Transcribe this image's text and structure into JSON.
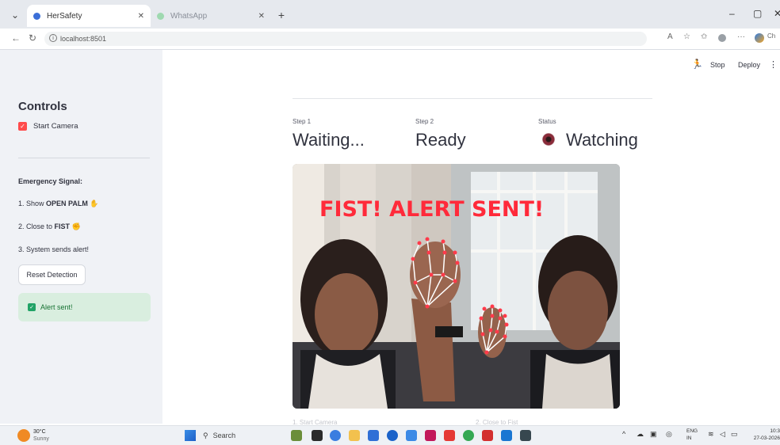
{
  "browser": {
    "tabs": [
      {
        "title": "HerSafety",
        "active": true
      },
      {
        "title": "WhatsApp",
        "active": false
      }
    ],
    "new_tab_label": "+",
    "url": "localhost:8501",
    "profile_label": "Ch"
  },
  "app": {
    "toolbar": {
      "stop_label": "Stop",
      "deploy_label": "Deploy",
      "menu_label": "⋮"
    },
    "sidebar": {
      "title": "Controls",
      "start_camera_label": "Start Camera",
      "start_camera_checked": true,
      "emergency_heading": "Emergency Signal:",
      "steps": [
        {
          "prefix": "1. Show ",
          "bold": "OPEN PALM",
          "emoji": "✋"
        },
        {
          "prefix": "2. Close to ",
          "bold": "FIST",
          "emoji": "✊"
        },
        {
          "prefix": "3. System sends alert!",
          "bold": "",
          "emoji": ""
        }
      ],
      "reset_button": "Reset Detection",
      "alert_message": "Alert sent!"
    },
    "metrics": [
      {
        "label": "Step 1",
        "value": "Waiting..."
      },
      {
        "label": "Step 2",
        "value": "Ready"
      },
      {
        "label": "Status",
        "value": "Watching"
      }
    ],
    "video_overlay_text": "FIST! ALERT SENT!",
    "below_video": [
      "1. Start Camera",
      "2. Close to Fist"
    ]
  },
  "taskbar": {
    "weather_temp": "30°C",
    "weather_desc": "Sunny",
    "search_label": "Search",
    "lang": "ENG",
    "region": "IN",
    "time": "10:3",
    "date": "27-03-2026"
  }
}
